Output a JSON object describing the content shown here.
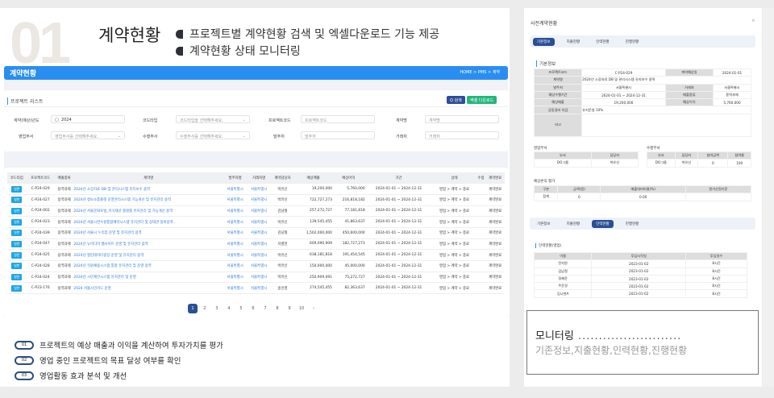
{
  "header": {
    "number": "01",
    "title": "계약현황",
    "features": [
      "프로젝트별 계약현황 검색 및 엑셀다운로드 기능 제공",
      "계약현황  상태 모니터링"
    ]
  },
  "app": {
    "title": "계약현황",
    "breadcrumb": "HOME  >  PMS  >  계약",
    "list_title": "프로젝트 리스트",
    "search_btn": "Q 검색",
    "excel_btn": "엑셀 다운로드",
    "filters": {
      "year_label": "계약(예상)년도",
      "year_value": "2024",
      "codetype_label": "코드타입",
      "codetype_value": "코드타입을 선택해주세요.",
      "code_label": "프로젝트코드",
      "code_ph": "프로젝트코드",
      "name_label": "계약명",
      "name_ph": "계약명",
      "sales_label": "영업부서",
      "sales_value": "영업부서를 선택해주세요.",
      "perf_label": "수행부서",
      "perf_value": "수행부서를 선택해주세요.",
      "client_label": "발주처",
      "client_ph": "발주처",
      "partner_label": "거래처",
      "partner_ph": "거래처"
    },
    "columns": [
      "코드타입",
      "프로젝트코드",
      "매출종류",
      "계약명",
      "발주처명",
      "거래처명",
      "계약담당자",
      "예상매출",
      "예상이익",
      "기간",
      "상태",
      "수정",
      "계약완료"
    ],
    "rows": [
      [
        "일반",
        "C-P24-029",
        "용역과제",
        "2024년 소장자료 DB 및 관리시스템 유지보수 용역",
        "서울특별시",
        "서울특별시",
        "박유신",
        "19,200,000",
        "5,760,000",
        "2024-01-01 ~ 2024-12-31",
        "영업 > 계약 > 종료",
        "",
        "계약완료"
      ],
      [
        "일반",
        "C-P24-027",
        "용역과제",
        "2024년 정보소통플랫 운영관리시스템 기능개선 및 유지관리 용역",
        "서울특별시",
        "서울특별시",
        "박유신",
        "722,727,273",
        "216,818,182",
        "2024-01-01 ~ 2024-12-31",
        "영업 > 계약 > 종료",
        "",
        "계약완료"
      ],
      [
        "일반",
        "C-P24-002",
        "용역과제",
        "2024년 서울문화포털_지식재산 플랫폼 유지관리 및 기능개선 용역",
        "서울특별시",
        "서울특별시",
        "김남철",
        "257,272,727",
        "77,181,818",
        "2024-01-01 ~ 2024-12-31",
        "영업 > 계약 > 종료",
        "",
        "계약완료"
      ],
      [
        "일반",
        "C-P24-023",
        "용역과제",
        "2024년 서울시연수원통합예약시스템 유지관리 및 상태관 정비용역...",
        "서울특별시",
        "서울특별시",
        "박유신",
        "139,545,455",
        "41,863,637",
        "2024-01-01 ~ 2024-12-31",
        "영업 > 계약 > 종료",
        "",
        "계약완료"
      ],
      [
        "일반",
        "C-P24-039",
        "용역과제",
        "2024년 서울시 누리집 운영 및 유지관리 용역",
        "서울특별시",
        "서울특별시",
        "김남철",
        "1,502,000,000",
        "450,600,000",
        "2024-01-01 ~ 2024-12-31",
        "영업 > 계약 > 종료",
        "",
        "계약완료"
      ],
      [
        "일반",
        "C-P24-047",
        "용역과제",
        "2024년 뉴미디어 웹사이트 운영 및 유지관리 용역",
        "서울특별시",
        "서울특별시",
        "지병헌",
        "609,090,909",
        "182,727,273",
        "2024-01-01 ~ 2024-12-31",
        "영업 > 계약 > 종료",
        "",
        "계약완료"
      ],
      [
        "일반",
        "C-P24-025",
        "용역과제",
        "2024년 열린데이터광장 운영 및 유지관리 용역",
        "서울특별시",
        "서울특별시",
        "박유신",
        "638,181,818",
        "191,454,545",
        "2024-01-01 ~ 2024-12-31",
        "영업 > 계약 > 종료",
        "",
        "계약완료"
      ],
      [
        "일반",
        "C-P24-028",
        "용역과제",
        "2024년 직원채용시스템 통합 유지관리 및 운영 용역",
        "서울특별시",
        "서울특별시",
        "박유신",
        "150,000,000",
        "45,000,000",
        "2024-01-01 ~ 2024-12-31",
        "영업 > 계약 > 종료",
        "",
        "계약완료"
      ],
      [
        "일반",
        "C-P24-024",
        "용역과제",
        "2024년 시민제안시스템 유지관리 및 운영",
        "서울특별시",
        "서울특별시",
        "박유신",
        "250,909,091",
        "75,272,727",
        "2024-01-01 ~ 2024-12-31",
        "영업 > 계약 > 종료",
        "",
        "계약완료"
      ],
      [
        "일반",
        "C-P23-176",
        "용역과제",
        "2024 서울시민카드 운영",
        "서울특별시",
        "서울특별시",
        "송인영",
        "274,545,455",
        "82,363,637",
        "2024-01-01 ~ 2024-12-31",
        "영업 > 계약 > 종료",
        "",
        "계약완료"
      ]
    ],
    "pages": [
      "1",
      "2",
      "3",
      "4",
      "5",
      "6",
      "7",
      "8",
      "9",
      "10",
      "›"
    ]
  },
  "benefits": [
    {
      "n": "01",
      "text": "프로젝트의 예상 매출과 이익을 계산하여 투자가치를 평가"
    },
    {
      "n": "02",
      "text": "영업 중인 프로젝트의 목표 달성 여부를 확인"
    },
    {
      "n": "03",
      "text": "영업활동 효과 분석 및 개선"
    }
  ],
  "modal": {
    "title": "사전계약현황",
    "close": "×",
    "tabs": [
      "기본정보",
      "지출현황",
      "인력현황",
      "진행현황"
    ],
    "info_title": "기본정보",
    "info": [
      [
        "프로젝트코드",
        "C-P24-029",
        "계약예상일",
        "2024-01-01"
      ],
      [
        "계약명",
        "2024년 소장자료 DB 및 관리시스템 유지보수 용역"
      ],
      [
        "발주처",
        "서울특별시",
        "거래처",
        "서울특별시"
      ],
      [
        "예상수행기간",
        "2024-01-01 ~ 2024-12-31",
        "매출종류",
        "용역과제"
      ],
      [
        "예상매출",
        "19,200,000",
        "예상이익",
        "5,760,000"
      ],
      [
        "공동경비 차감",
        "유지운영 10%"
      ],
      [
        "비고",
        ""
      ]
    ],
    "sales_title": "영업부서",
    "sales_cols": [
      "부서",
      "담당자"
    ],
    "sales_row": [
      "DO그룹",
      "박유신"
    ],
    "perf_title": "수행부서",
    "perf_cols": [
      "부서",
      "담당자",
      "참여금액",
      "참여율"
    ],
    "perf_row": [
      "DO그룹",
      "박유신",
      "0",
      "100"
    ],
    "pl_title": "예상손익 평가",
    "pl_cols": [
      "구분",
      "금액(원)",
      "매출대비비율(%)",
      "원가산정기준"
    ],
    "pl_row": [
      "합계",
      "0",
      "0.00",
      ""
    ],
    "tabs2_active": 2,
    "staff_title": "인력현황(영업)",
    "staff_cols": [
      "이름",
      "투입시작일",
      "투입일수"
    ],
    "staff": [
      [
        "전지원",
        "2023-01-02",
        "8시간"
      ],
      [
        "김남철",
        "2023-01-02",
        "8시간"
      ],
      [
        "정혜윤",
        "2023-01-02",
        "8시간"
      ],
      [
        "주윤경",
        "2023-01-02",
        "8시간"
      ],
      [
        "김나현A",
        "2023-01-02",
        "8시간"
      ]
    ]
  },
  "overlay": {
    "title": "모니터링",
    "subtitle": "기존정보,지출현황,인력현황,진행현황"
  }
}
